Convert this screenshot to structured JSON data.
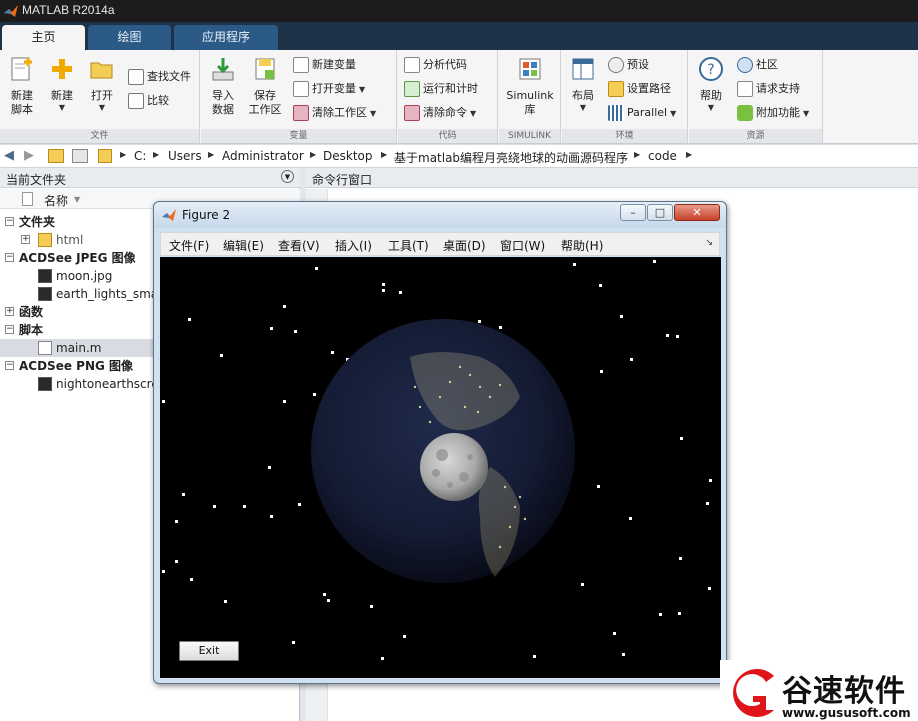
{
  "app": {
    "title": "MATLAB R2014a"
  },
  "ribbon_tabs": [
    "主页",
    "绘图",
    "应用程序"
  ],
  "ribbon": {
    "file": {
      "label": "文件",
      "new_script": "新建\n脚本",
      "new": "新建",
      "open": "打开",
      "find_files": "查找文件",
      "compare": "比较"
    },
    "variable": {
      "label": "变量",
      "import": "导入\n数据",
      "save_ws": "保存\n工作区",
      "new_var": "新建变量",
      "open_var": "打开变量",
      "clear_ws": "清除工作区"
    },
    "code": {
      "label": "代码",
      "analyze": "分析代码",
      "run_time": "运行和计时",
      "clear_cmd": "清除命令"
    },
    "simulink": {
      "label": "SIMULINK",
      "lib": "Simulink\n库"
    },
    "env": {
      "label": "环境",
      "layout": "布局",
      "prefs": "预设",
      "set_path": "设置路径",
      "parallel": "Parallel"
    },
    "resources": {
      "label": "资源",
      "help": "帮助",
      "community": "社区",
      "support": "请求支持",
      "addons": "附加功能"
    }
  },
  "path": [
    "C:",
    "Users",
    "Administrator",
    "Desktop",
    "基于matlab编程月亮绕地球的动画源码程序",
    "code"
  ],
  "left_panel": {
    "title": "当前文件夹",
    "col_name": "名称",
    "tree": [
      {
        "label": "文件夹",
        "bold": true,
        "kind": "group"
      },
      {
        "label": "html",
        "bold": false,
        "kind": "folder"
      },
      {
        "label": "ACDSee JPEG 图像",
        "bold": true,
        "kind": "group"
      },
      {
        "label": "moon.jpg",
        "bold": false,
        "kind": "jpg"
      },
      {
        "label": "earth_lights_sma",
        "bold": false,
        "kind": "jpg"
      },
      {
        "label": "函数",
        "bold": true,
        "kind": "group-collapsed"
      },
      {
        "label": "脚本",
        "bold": true,
        "kind": "group"
      },
      {
        "label": "main.m",
        "bold": false,
        "kind": "m"
      },
      {
        "label": "ACDSee PNG 图像",
        "bold": true,
        "kind": "group"
      },
      {
        "label": "nightonearthscre",
        "bold": false,
        "kind": "png"
      }
    ]
  },
  "right_panel": {
    "title": "命令行窗口"
  },
  "figure": {
    "title": "Figure 2",
    "menus": [
      "文件(F)",
      "编辑(E)",
      "查看(V)",
      "插入(I)",
      "工具(T)",
      "桌面(D)",
      "窗口(W)",
      "帮助(H)"
    ],
    "exit_label": "Exit"
  },
  "watermark": {
    "name": "谷速软件",
    "url": "www.gususoft.com"
  },
  "colors": {
    "tab_active": "#f5f5f5",
    "tab_inactive": "#2c5a86",
    "tabbar_bg": "#1f3348",
    "title_bg": "#1c1c1c",
    "brand_red": "#e0151a"
  }
}
